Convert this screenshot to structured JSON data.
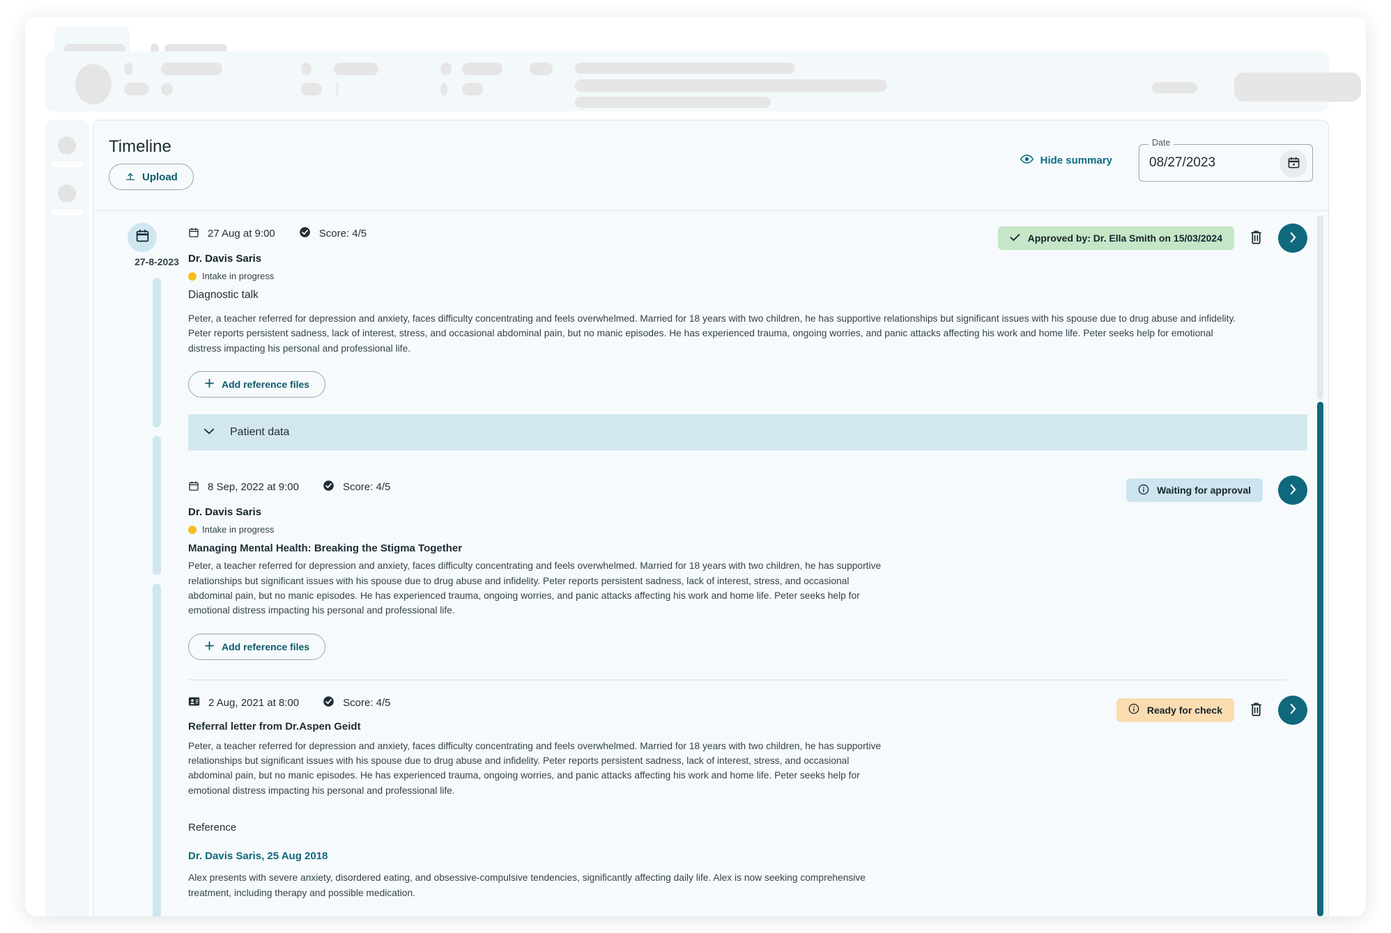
{
  "header": {
    "title": "Timeline",
    "upload_label": "Upload",
    "hide_summary_label": "Hide summary",
    "date_legend": "Date",
    "date_value": "08/27/2023"
  },
  "timeline": {
    "marker_date": "27-8-2023"
  },
  "common": {
    "add_reference_files": "Add reference files",
    "score_label": "Score: 4/5",
    "doctor": "Dr. Davis Saris",
    "status_text": "Intake in progress",
    "status_color": "#f5bf1e",
    "accent_color": "#10687c"
  },
  "entries": [
    {
      "datetime": "27 Aug at 9:00",
      "score": "Score: 4/5",
      "doctor": "Dr. Davis Saris",
      "status": "Intake in progress",
      "subject": "Diagnostic talk",
      "body": "Peter, a teacher referred for depression and anxiety, faces difficulty concentrating and feels overwhelmed. Married for 18 years with two children, he has supportive relationships but significant issues with his spouse due to drug abuse and infidelity. Peter reports persistent sadness, lack of interest, stress, and occasional abdominal pain, but no manic episodes. He has experienced trauma, ongoing worries, and panic attacks affecting his work and home life. Peter seeks help for emotional distress impacting his personal and professional life.",
      "badge": "Approved by: Dr. Ella Smith on 15/03/2024",
      "badge_type": "approved",
      "add_files": "Add reference files",
      "accordion": "Patient data"
    },
    {
      "datetime": "8 Sep, 2022 at 9:00",
      "score": "Score: 4/5",
      "doctor": "Dr. Davis Saris",
      "status": "Intake in progress",
      "subject": "Managing Mental Health: Breaking the Stigma Together",
      "body": "Peter, a teacher referred for depression and anxiety, faces difficulty concentrating and feels overwhelmed. Married for 18 years with two children, he has supportive relationships but significant issues with his spouse due to drug abuse and infidelity. Peter reports persistent sadness, lack of interest, stress, and occasional abdominal pain, but no manic episodes. He has experienced trauma, ongoing worries, and panic attacks affecting his work and home life. Peter seeks help for emotional distress impacting his personal and professional life.",
      "badge": "Waiting for approval",
      "badge_type": "waiting",
      "add_files": "Add reference files"
    },
    {
      "datetime": "2 Aug, 2021 at 8:00",
      "score": "Score: 4/5",
      "subject": "Referral letter from Dr.Aspen Geidt",
      "body": "Peter, a teacher referred for depression and anxiety, faces difficulty concentrating and feels overwhelmed. Married for 18 years with two children, he has supportive relationships but significant issues with his spouse due to drug abuse and infidelity. Peter reports persistent sadness, lack of interest, stress, and occasional abdominal pain, but no manic episodes. He has experienced trauma, ongoing worries, and panic attacks affecting his work and home life. Peter seeks help for emotional distress impacting his personal and professional life.",
      "badge": "Ready for check",
      "badge_type": "ready",
      "reference_heading": "Reference",
      "reference_link": "Dr. Davis Saris, 25 Aug 2018",
      "reference_body": "Alex presents with severe anxiety, disordered eating, and obsessive-compulsive tendencies, significantly affecting daily life. Alex is now seeking comprehensive treatment, including therapy and possible medication."
    }
  ]
}
